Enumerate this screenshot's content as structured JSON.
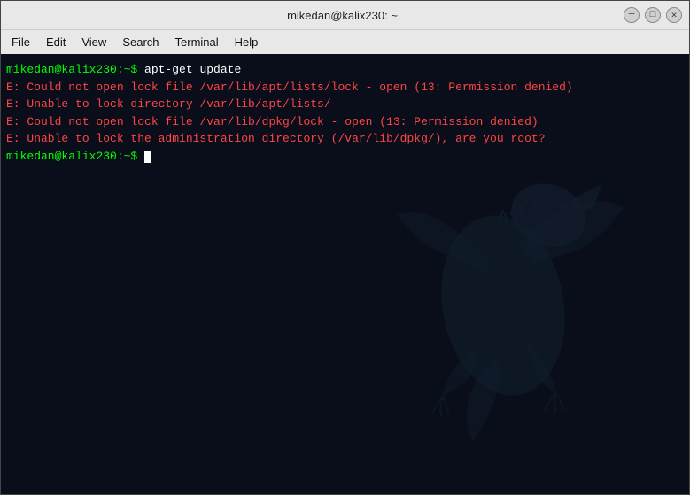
{
  "titlebar": {
    "title": "mikedan@kalix230: ~",
    "minimize_label": "─",
    "maximize_label": "□",
    "close_label": "✕"
  },
  "menubar": {
    "items": [
      {
        "id": "file",
        "label": "File"
      },
      {
        "id": "edit",
        "label": "Edit"
      },
      {
        "id": "view",
        "label": "View"
      },
      {
        "id": "search",
        "label": "Search"
      },
      {
        "id": "terminal",
        "label": "Terminal"
      },
      {
        "id": "help",
        "label": "Help"
      }
    ]
  },
  "terminal": {
    "lines": [
      {
        "type": "prompt_command",
        "prompt": "mikedan@kalix230:~$ ",
        "command": "apt-get update"
      },
      {
        "type": "error",
        "text": "E: Could not open lock file /var/lib/apt/lists/lock - open (13: Permission denied)"
      },
      {
        "type": "error",
        "text": "E: Unable to lock directory /var/lib/apt/lists/"
      },
      {
        "type": "error",
        "text": "E: Could not open lock file /var/lib/dpkg/lock - open (13: Permission denied)"
      },
      {
        "type": "error",
        "text": "E: Unable to lock the administration directory (/var/lib/dpkg/), are you root?"
      },
      {
        "type": "prompt_cursor",
        "prompt": "mikedan@kalix230:~$ "
      }
    ]
  }
}
